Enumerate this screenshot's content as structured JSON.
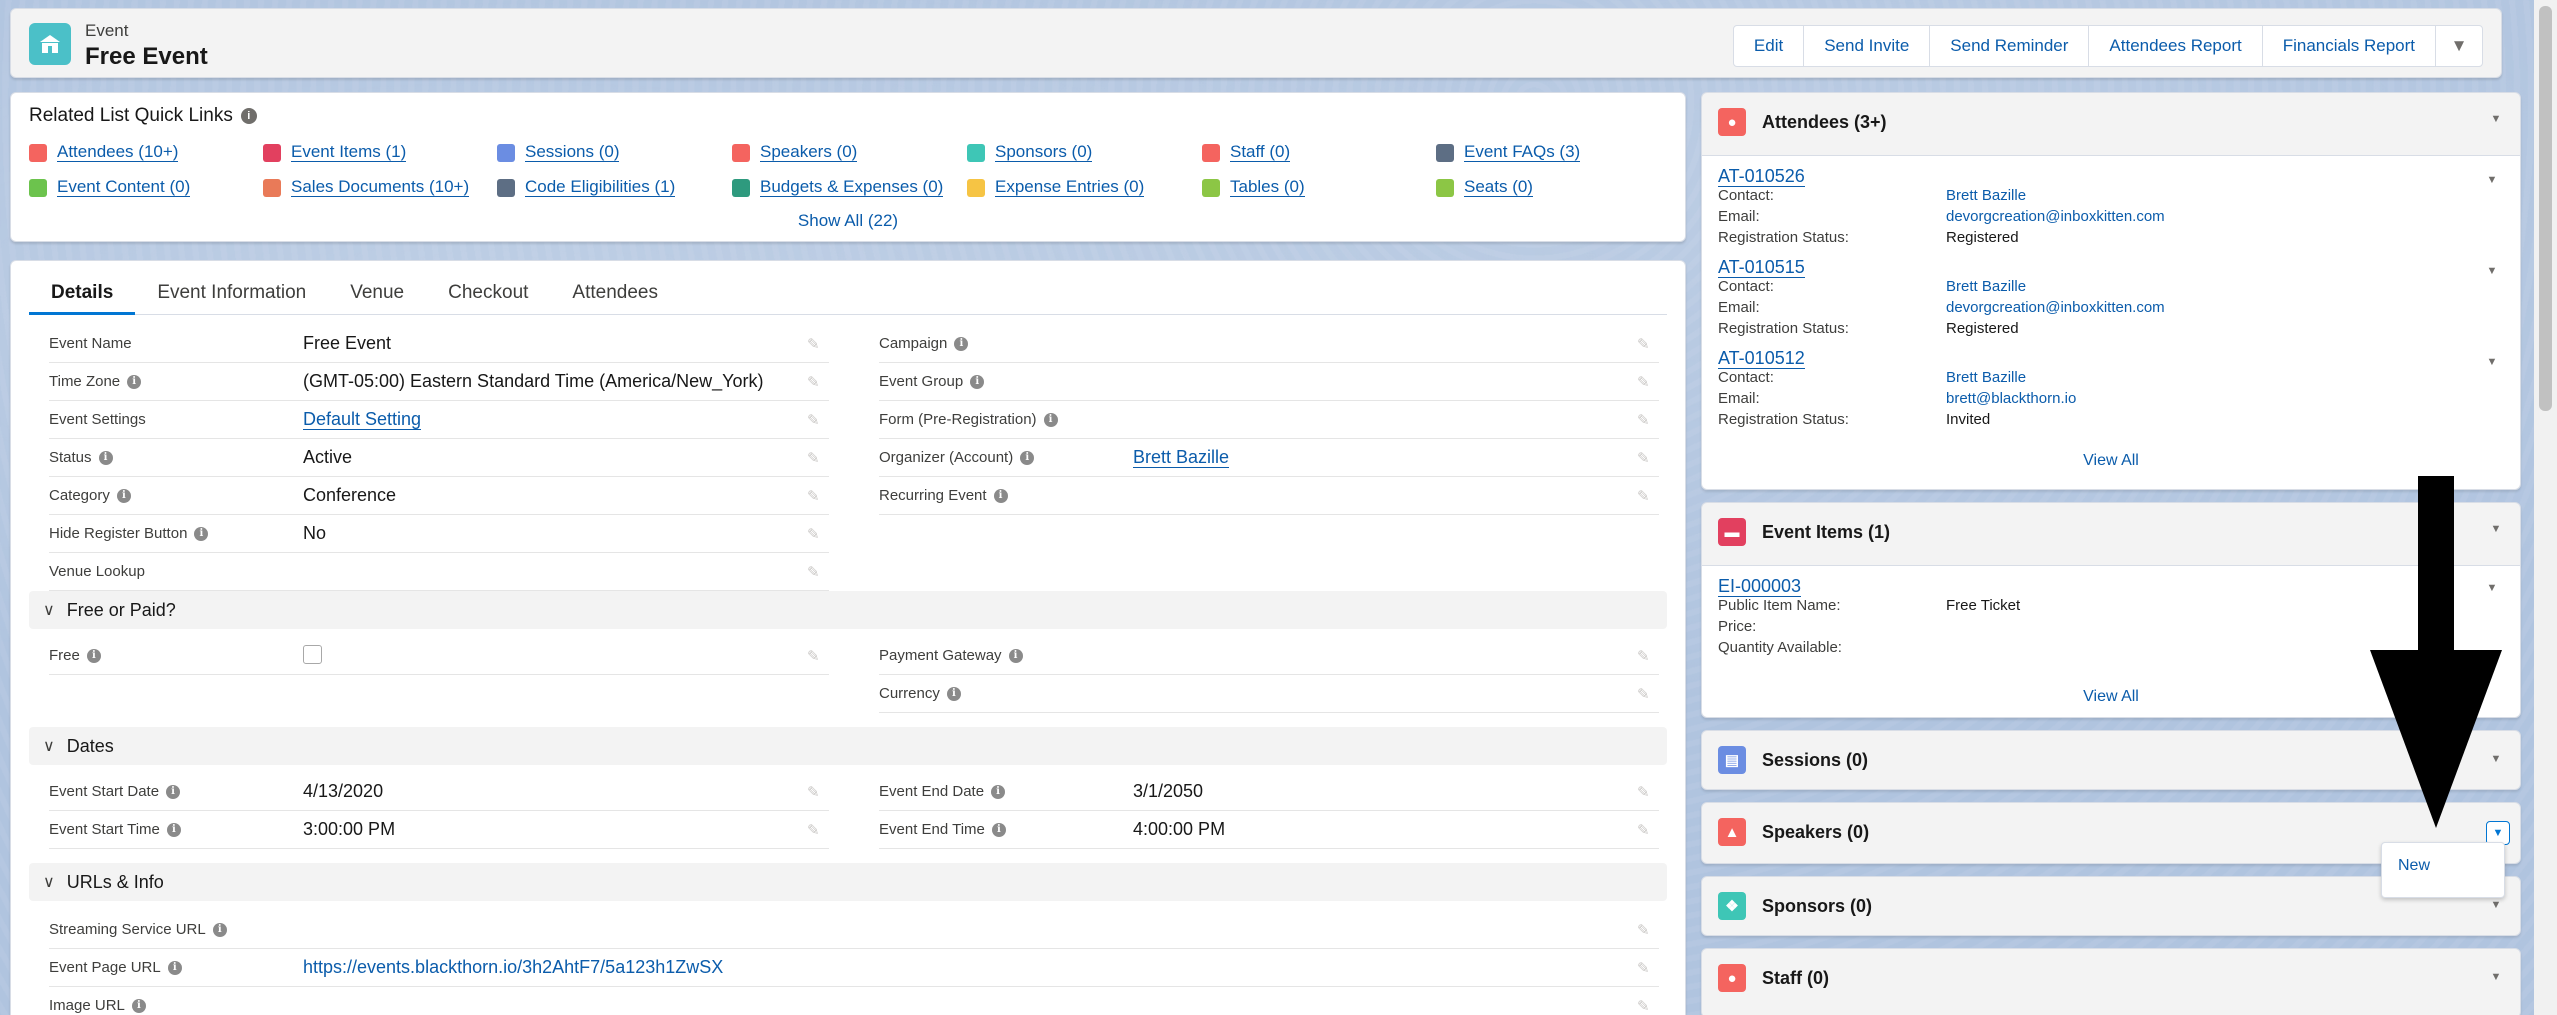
{
  "header": {
    "object_type": "Event",
    "record_name": "Free Event",
    "buttons": [
      "Edit",
      "Send Invite",
      "Send Reminder",
      "Attendees Report",
      "Financials Report"
    ]
  },
  "quick_links": {
    "title": "Related List Quick Links",
    "items": [
      {
        "label": "Attendees (10+)",
        "color": "#f4645f"
      },
      {
        "label": "Event Items (1)",
        "color": "#e2405f"
      },
      {
        "label": "Sessions (0)",
        "color": "#6b8de2"
      },
      {
        "label": "Speakers (0)",
        "color": "#f4645f"
      },
      {
        "label": "Sponsors (0)",
        "color": "#3ec6b6"
      },
      {
        "label": "Staff (0)",
        "color": "#f4645f"
      },
      {
        "label": "Event FAQs (3)",
        "color": "#5d6e84"
      },
      {
        "label": "Event Content (0)",
        "color": "#6cc34d"
      },
      {
        "label": "Sales Documents (10+)",
        "color": "#e97a58"
      },
      {
        "label": "Code Eligibilities (1)",
        "color": "#5d6e84"
      },
      {
        "label": "Budgets & Expenses (0)",
        "color": "#2e9a7e"
      },
      {
        "label": "Expense Entries (0)",
        "color": "#f6c444"
      },
      {
        "label": "Tables (0)",
        "color": "#8cc645"
      },
      {
        "label": "Seats (0)",
        "color": "#8cc645"
      }
    ],
    "show_all": "Show All (22)"
  },
  "tabs": [
    "Details",
    "Event Information",
    "Venue",
    "Checkout",
    "Attendees"
  ],
  "details": {
    "left": [
      {
        "label": "Event Name",
        "value": "Free Event",
        "info": false,
        "link": false
      },
      {
        "label": "Time Zone",
        "value": "(GMT-05:00) Eastern Standard Time (America/New_York)",
        "info": true,
        "link": false
      },
      {
        "label": "Event Settings",
        "value": "Default Setting",
        "info": false,
        "link": true
      },
      {
        "label": "Status",
        "value": "Active",
        "info": true,
        "link": false
      },
      {
        "label": "Category",
        "value": "Conference",
        "info": true,
        "link": false
      },
      {
        "label": "Hide Register Button",
        "value": "No",
        "info": true,
        "link": false
      },
      {
        "label": "Venue Lookup",
        "value": "",
        "info": false,
        "link": false
      }
    ],
    "right": [
      {
        "label": "Campaign",
        "value": "",
        "info": true,
        "link": false
      },
      {
        "label": "Event Group",
        "value": "",
        "info": true,
        "link": false
      },
      {
        "label": "Form (Pre-Registration)",
        "value": "",
        "info": true,
        "link": false
      },
      {
        "label": "Organizer (Account)",
        "value": "Brett Bazille",
        "info": true,
        "link": true
      },
      {
        "label": "Recurring Event",
        "value": "",
        "info": true,
        "link": false
      }
    ]
  },
  "sections": {
    "free_or_paid": {
      "title": "Free or Paid?",
      "free_label": "Free",
      "payment_gateway_label": "Payment Gateway",
      "currency_label": "Currency"
    },
    "dates": {
      "title": "Dates",
      "start_date_label": "Event Start Date",
      "start_date": "4/13/2020",
      "start_time_label": "Event Start Time",
      "start_time": "3:00:00 PM",
      "end_date_label": "Event End Date",
      "end_date": "3/1/2050",
      "end_time_label": "Event End Time",
      "end_time": "4:00:00 PM"
    },
    "urls": {
      "title": "URLs & Info",
      "streaming_label": "Streaming Service URL",
      "page_url_label": "Event Page URL",
      "page_url": "https://events.blackthorn.io/3h2AhtF7/5a123h1ZwSX",
      "image_url_label": "Image URL"
    }
  },
  "attendees_card": {
    "title": "Attendees (3+)",
    "records": [
      {
        "id": "AT-010526",
        "contact_label": "Contact:",
        "contact": "Brett Bazille",
        "email_label": "Email:",
        "email": "devorgcreation@inboxkitten.com",
        "status_label": "Registration Status:",
        "status": "Registered"
      },
      {
        "id": "AT-010515",
        "contact_label": "Contact:",
        "contact": "Brett Bazille",
        "email_label": "Email:",
        "email": "devorgcreation@inboxkitten.com",
        "status_label": "Registration Status:",
        "status": "Registered"
      },
      {
        "id": "AT-010512",
        "contact_label": "Contact:",
        "contact": "Brett Bazille",
        "email_label": "Email:",
        "email": "brett@blackthorn.io",
        "status_label": "Registration Status:",
        "status": "Invited"
      }
    ],
    "view_all": "View All"
  },
  "event_items_card": {
    "title": "Event Items (1)",
    "record": {
      "id": "EI-000003",
      "name_label": "Public Item Name:",
      "name": "Free Ticket",
      "price_label": "Price:",
      "qty_label": "Quantity Available:"
    },
    "view_all": "View All"
  },
  "collapsed_cards": [
    {
      "title": "Sessions (0)",
      "color": "#6b8de2"
    },
    {
      "title": "Speakers (0)",
      "color": "#f4645f"
    },
    {
      "title": "Sponsors (0)",
      "color": "#3ec6b6"
    },
    {
      "title": "Staff (0)",
      "color": "#f4645f"
    }
  ],
  "dropdown_menu": {
    "items": [
      "New"
    ]
  },
  "colors": {
    "accent": "#0176d3",
    "link": "#0b5cab",
    "event_icon": "#4bc0c8",
    "attendee_icon": "#f4645f",
    "event_item_icon": "#e2405f"
  }
}
